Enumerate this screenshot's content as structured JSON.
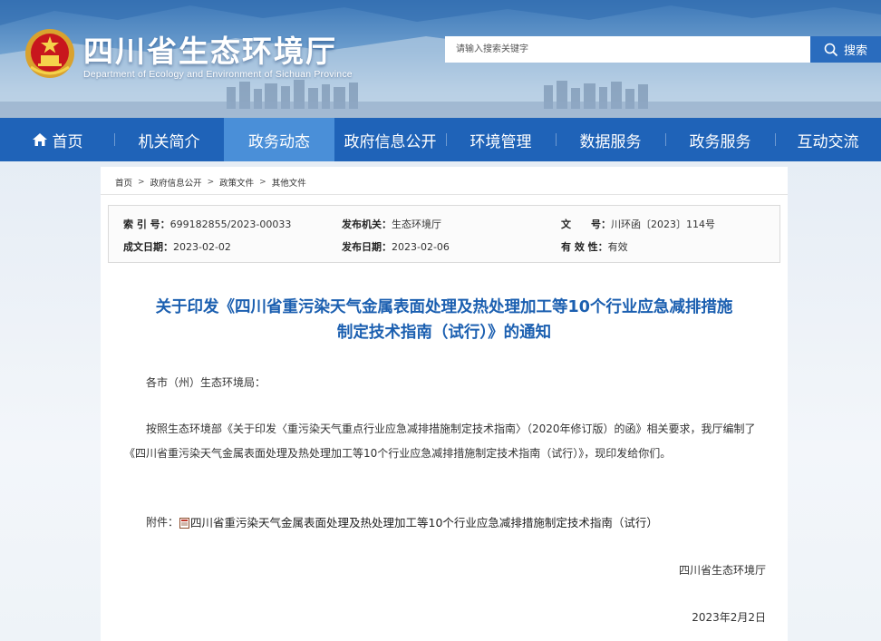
{
  "header": {
    "title": "四川省生态环境厅",
    "subtitle": "Department of Ecology and Environment of Sichuan Province",
    "search_placeholder": "请输入搜索关键字",
    "search_button": "搜索"
  },
  "nav": {
    "items": [
      {
        "label": "首页",
        "icon": "home-icon"
      },
      {
        "label": "机关简介"
      },
      {
        "label": "政务动态",
        "active": true
      },
      {
        "label": "政府信息公开"
      },
      {
        "label": "环境管理"
      },
      {
        "label": "数据服务"
      },
      {
        "label": "政务服务"
      },
      {
        "label": "互动交流"
      }
    ]
  },
  "breadcrumb": [
    "首页",
    "政府信息公开",
    "政策文件",
    "其他文件"
  ],
  "meta": {
    "index_label": "索 引 号：",
    "index_value": "699182855/2023-00033",
    "org_label": "发布机关：",
    "org_value": "生态环境厅",
    "docno_label": "文　　号：",
    "docno_value": "川环函〔2023〕114号",
    "created_label": "成文日期：",
    "created_value": "2023-02-02",
    "published_label": "发布日期：",
    "published_value": "2023-02-06",
    "validity_label": "有 效 性：",
    "validity_value": "有效"
  },
  "document": {
    "title_line1": "关于印发《四川省重污染天气金属表面处理及热处理加工等10个行业应急减排措施",
    "title_line2": "制定技术指南（试行）》的通知",
    "salutation": "各市（州）生态环境局：",
    "paragraph": "按照生态环境部《关于印发〈重污染天气重点行业应急减排措施制定技术指南〉（2020年修订版）的函》相关要求，我厅编制了《四川省重污染天气金属表面处理及热处理加工等10个行业应急减排措施制定技术指南（试行）》，现印发给你们。",
    "attachment_label": "附件：",
    "attachment_link": "四川省重污染天气金属表面处理及热处理加工等10个行业应急减排措施制定技术指南（试行）",
    "signature": "四川省生态环境厅",
    "date": "2023年2月2日"
  },
  "colors": {
    "nav_bg": "#1f63b8",
    "nav_active": "#4a8fd8",
    "title_blue": "#1b5fb0"
  }
}
